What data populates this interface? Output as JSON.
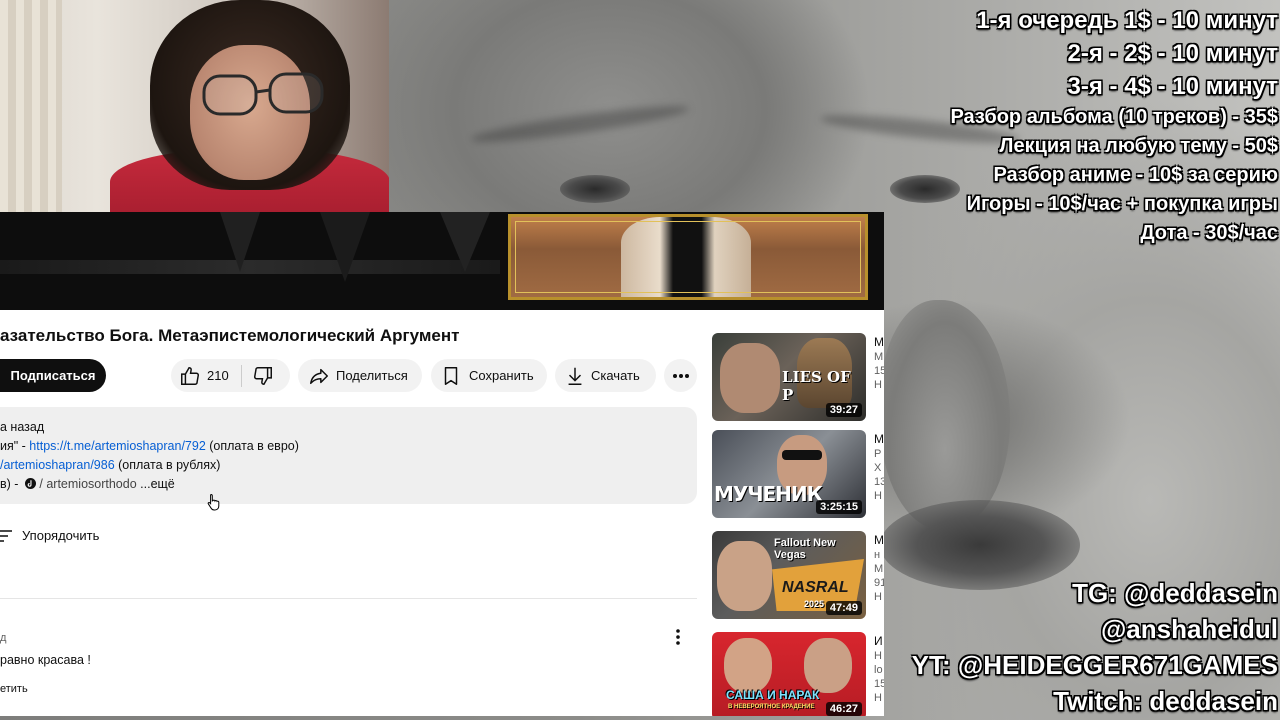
{
  "price_list": {
    "large": [
      "1-я очередь 1$ - 10 минут",
      "2-я - 2$ - 10 минут",
      "3-я - 4$ - 10 минут"
    ],
    "small": [
      "Разбор альбома (10 треков) - 35$",
      "Лекция на любую тему - 50$",
      "Разбор аниме - 10$ за серию",
      "Игоры - 10$/час + покупка игры",
      "Дота - 30$/час"
    ]
  },
  "socials": [
    "TG: @deddasein",
    "@anshaheidul",
    "YT: @HEIDEGGER671GAMES",
    "Twitch: deddasein"
  ],
  "youtube": {
    "title": "азательство Бога. Метаэпистемологический Аргумент",
    "subscribe_label": "Подписаться",
    "like_count": "210",
    "share_label": "Поделиться",
    "save_label": "Сохранить",
    "download_label": "Скачать",
    "description": {
      "line1": "а назад",
      "line2_prefix": "ия\" - ",
      "line2_link": "https://t.me/artemioshapran/792",
      "line2_suffix": " (оплата в евро)",
      "line3_link": "/artemioshapran/986",
      "line3_suffix": " (оплата в рублях)",
      "line4_prefix": "в) - ",
      "line4_text": " / artemiosorthodo",
      "more_label": "...ещё"
    },
    "sort_label": "Упорядочить",
    "comment": {
      "meta": "д",
      "text": "равно красава !",
      "reply_label": "етить"
    },
    "recommended": [
      {
        "thumb_text": "LIES OF P",
        "duration": "39:27",
        "title_initial": "М",
        "meta": [
          "М",
          "15",
          "Н"
        ]
      },
      {
        "thumb_text": "МУЧЕНИК",
        "duration": "3:25:15",
        "title_initial": "М",
        "meta": [
          "Р",
          "Х",
          "13",
          "Н"
        ]
      },
      {
        "thumb_text": "Fallout New Vegas",
        "thumb_text2": "NASRAL",
        "thumb_text3": "2025",
        "duration": "47:49",
        "title_initial": "М",
        "meta": [
          "н",
          "М",
          "91",
          "Н"
        ]
      },
      {
        "thumb_text": "САША И НАРАК",
        "thumb_text2": "В НЕВЕРОЯТНОЕ КРАДЕНИЕ",
        "duration": "46:27",
        "title_initial": "И",
        "meta": [
          "Н",
          "lo",
          "15",
          "Н"
        ]
      }
    ]
  },
  "colors": {
    "link": "#065fd4",
    "gold_frame": "#b8902c",
    "webcam_shirt": "#c52a3c"
  }
}
